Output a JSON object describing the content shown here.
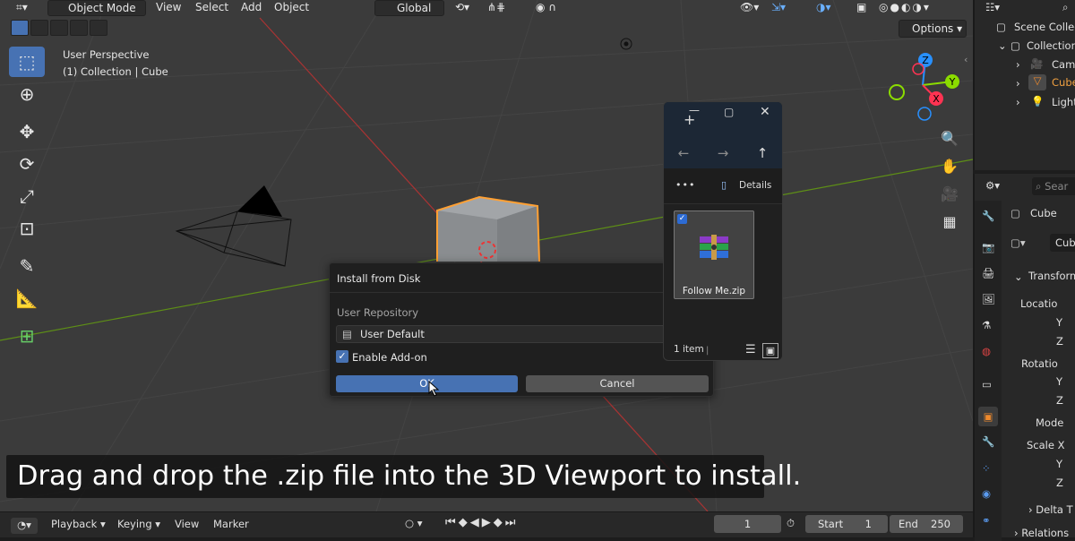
{
  "topbar": {
    "mode": "Object Mode",
    "menu": [
      "View",
      "Select",
      "Add",
      "Object"
    ],
    "transform_orientation": "Global",
    "options": "Options"
  },
  "viewport": {
    "perspective": "User Perspective",
    "collection": "(1) Collection | Cube"
  },
  "gizmo": {
    "z": "Z",
    "y": "Y",
    "x": "X"
  },
  "dialog": {
    "title": "Install from Disk",
    "repo_label": "User Repository",
    "repo_value": "User Default",
    "enable_label": "Enable Add-on",
    "enable_checked": true,
    "ok_label": "OK",
    "cancel_label": "Cancel"
  },
  "explorer": {
    "details_label": "Details",
    "more_label": "•••",
    "file_name": "Follow Me.zip",
    "status": "1 item"
  },
  "outliner": {
    "scene": "Scene Collec",
    "collection": "Collection",
    "items": [
      "Came",
      "Cube",
      "Light"
    ]
  },
  "properties": {
    "search_placeholder": "Sear",
    "object_name": "Cube",
    "data_name": "Cube",
    "transform": "Transform",
    "location": "Locatio",
    "y1": "Y",
    "z1": "Z",
    "rotation": "Rotatio",
    "y2": "Y",
    "z2": "Z",
    "mode": "Mode",
    "scale": "Scale X",
    "y3": "Y",
    "z3": "Z",
    "delta": "Delta T",
    "relations": "Relations"
  },
  "caption": "Drag and drop the .zip file into the 3D Viewport to install.",
  "timeline": {
    "playback": "Playback",
    "keying": "Keying",
    "view": "View",
    "marker": "Marker",
    "current_frame": "1",
    "start_label": "Start",
    "start_value": "1",
    "end_label": "End",
    "end_value": "250"
  },
  "colors": {
    "accent": "#4772b3",
    "cube_outline": "#ffa033",
    "x_axis": "#ff3352",
    "y_axis": "#8bdc00",
    "z_axis": "#2890ff"
  }
}
